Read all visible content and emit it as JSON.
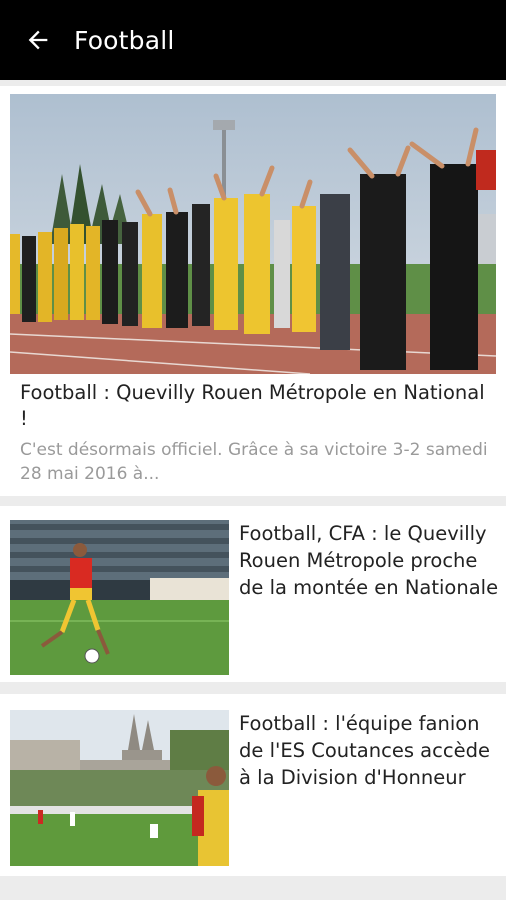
{
  "app_bar": {
    "title": "Football",
    "back_icon": "arrow-left-icon"
  },
  "colors": {
    "app_bar_bg": "#000000",
    "page_bg": "#ececec",
    "card_bg": "#ffffff",
    "title_text": "#222222",
    "excerpt_text": "#9a9a9a"
  },
  "articles": [
    {
      "title": "Football : Quevilly Rouen Métropole en National !",
      "excerpt": "C'est désormais officiel. Grâce à sa victoire 3-2 samedi 28 mai 2016 à..."
    },
    {
      "title": "Football, CFA : le Quevilly Rouen Métropole proche de la montée en Nationale"
    },
    {
      "title": "Football : l'équipe fanion de l'ES Coutances accède à la Division d'Honneur"
    }
  ]
}
